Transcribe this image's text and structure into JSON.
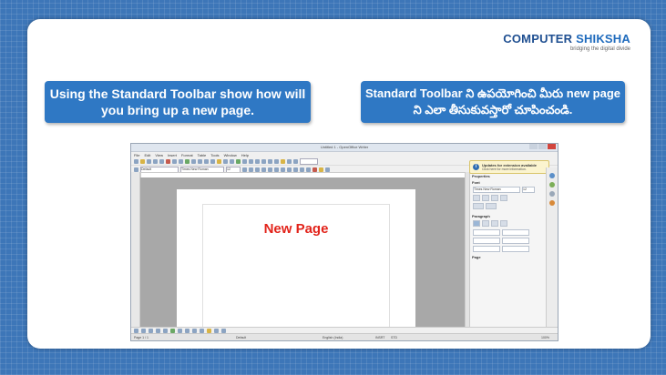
{
  "logo": {
    "brand": "COMPUTER SHIKSHA",
    "brand_a": "COMPUTER ",
    "brand_b": "SHIKSHA",
    "tagline": "bridging the digital divide"
  },
  "callouts": {
    "english": "Using the Standard Toolbar show how will you bring up a new page.",
    "telugu": "Standard Toolbar ని ఉపయోగించి మీరు new page ని ఎలా తీసుకువస్తారో చూపించండి."
  },
  "app": {
    "title": "Untitled 1 - OpenOffice Writer",
    "menu": [
      "File",
      "Edit",
      "View",
      "Insert",
      "Format",
      "Table",
      "Tools",
      "Window",
      "Help"
    ],
    "style_value": "Default",
    "font_value": "Times New Roman",
    "size_value": "12",
    "notification": {
      "title": "Updates for extension available",
      "subtitle": "Click here for more information."
    },
    "sidebar": {
      "properties": "Properties",
      "font": "Font",
      "paragraph": "Paragraph",
      "page": "Page",
      "font_name": "Times New Roman",
      "font_size": "12"
    },
    "document_text": "New Page",
    "status": {
      "page": "Page 1 / 1",
      "style": "Default",
      "language": "English (India)",
      "mode": "INSRT",
      "selection": "STD",
      "zoom": "100%"
    }
  },
  "colors": {
    "background": "#3d76b8",
    "callout": "#2f78c4",
    "new_page_text": "#e2231a"
  }
}
